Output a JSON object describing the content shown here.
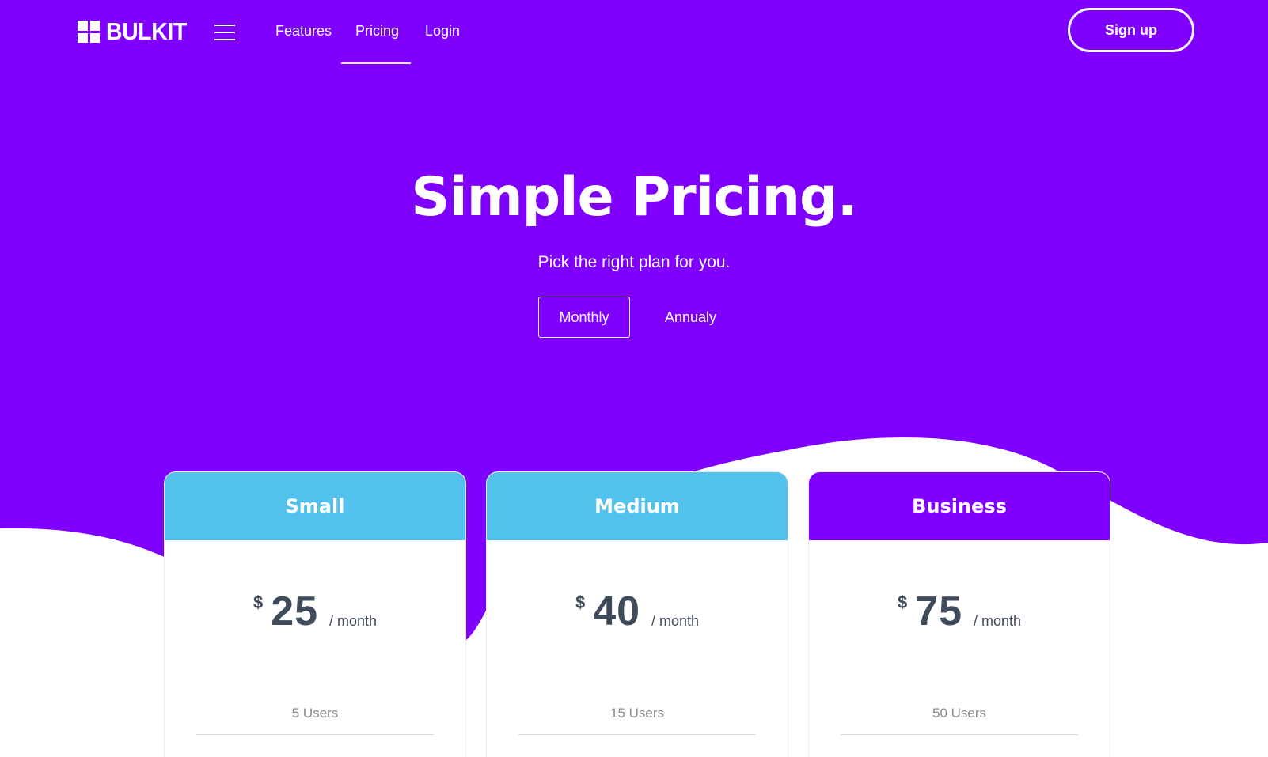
{
  "colors": {
    "hero_purple": "#7f00ff",
    "card_blue": "#52c1eb",
    "card_purple": "#7f00ff",
    "price_text": "#3f4a5a",
    "muted_text": "#8a8a8a"
  },
  "nav": {
    "brand": "BULKIT",
    "logo_icon": "grid-logo-icon",
    "menu_icon": "hamburger-icon",
    "links": [
      "Features",
      "Pricing",
      "Login"
    ],
    "active_link": "Pricing",
    "signup_label": "Sign up"
  },
  "hero": {
    "title": "Simple Pricing.",
    "subtitle": "Pick the right plan for you.",
    "billing_options": [
      "Monthly",
      "Annualy"
    ],
    "selected_billing": "Monthly"
  },
  "plans": [
    {
      "name": "Small",
      "currency": "$",
      "price": "25",
      "period": "/ month",
      "feature": "5 Users",
      "header_color": "#52c1eb"
    },
    {
      "name": "Medium",
      "currency": "$",
      "price": "40",
      "period": "/ month",
      "feature": "15 Users",
      "header_color": "#52c1eb"
    },
    {
      "name": "Business",
      "currency": "$",
      "price": "75",
      "period": "/ month",
      "feature": "50 Users",
      "header_color": "#7f00ff"
    }
  ]
}
